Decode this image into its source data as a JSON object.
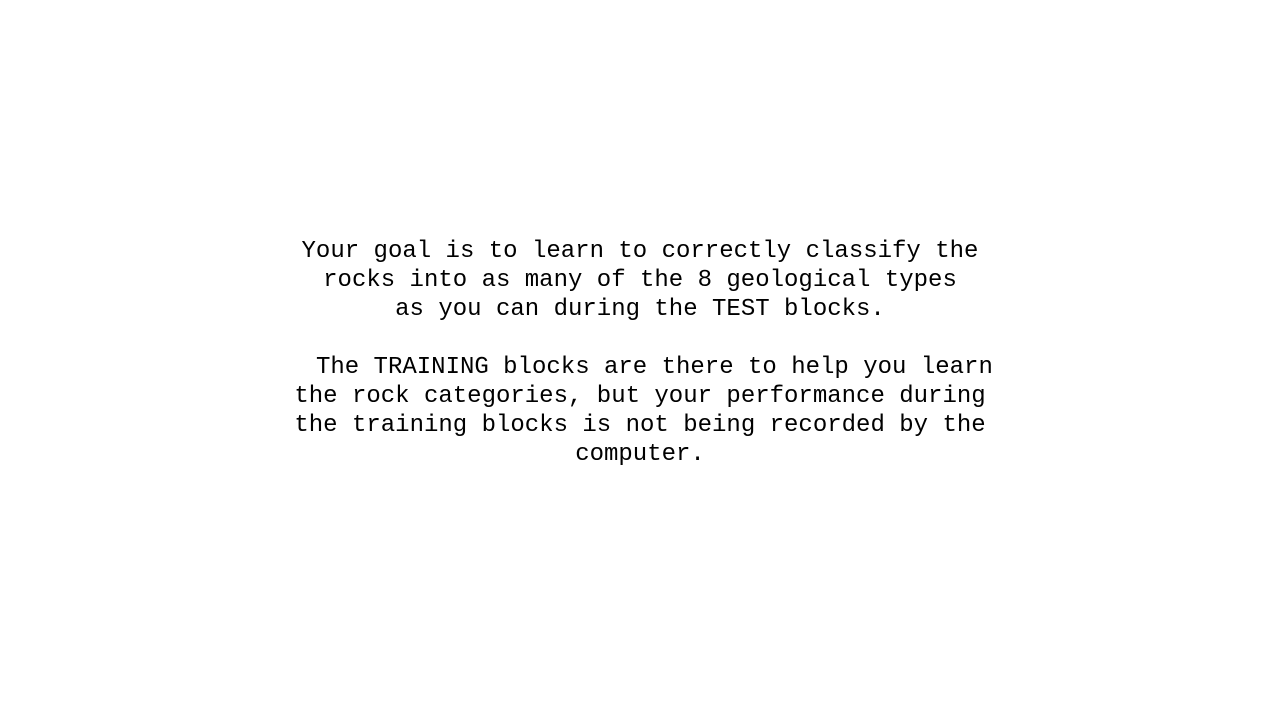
{
  "instructions": {
    "paragraph_1": [
      "Your goal is to learn to correctly classify the",
      "rocks into as many of the 8 geological types",
      "as you can during the TEST blocks."
    ],
    "paragraph_2": [
      "  The TRAINING blocks are there to help you learn",
      "the rock categories, but your performance during",
      "the training blocks is not being recorded by the",
      "computer."
    ]
  }
}
